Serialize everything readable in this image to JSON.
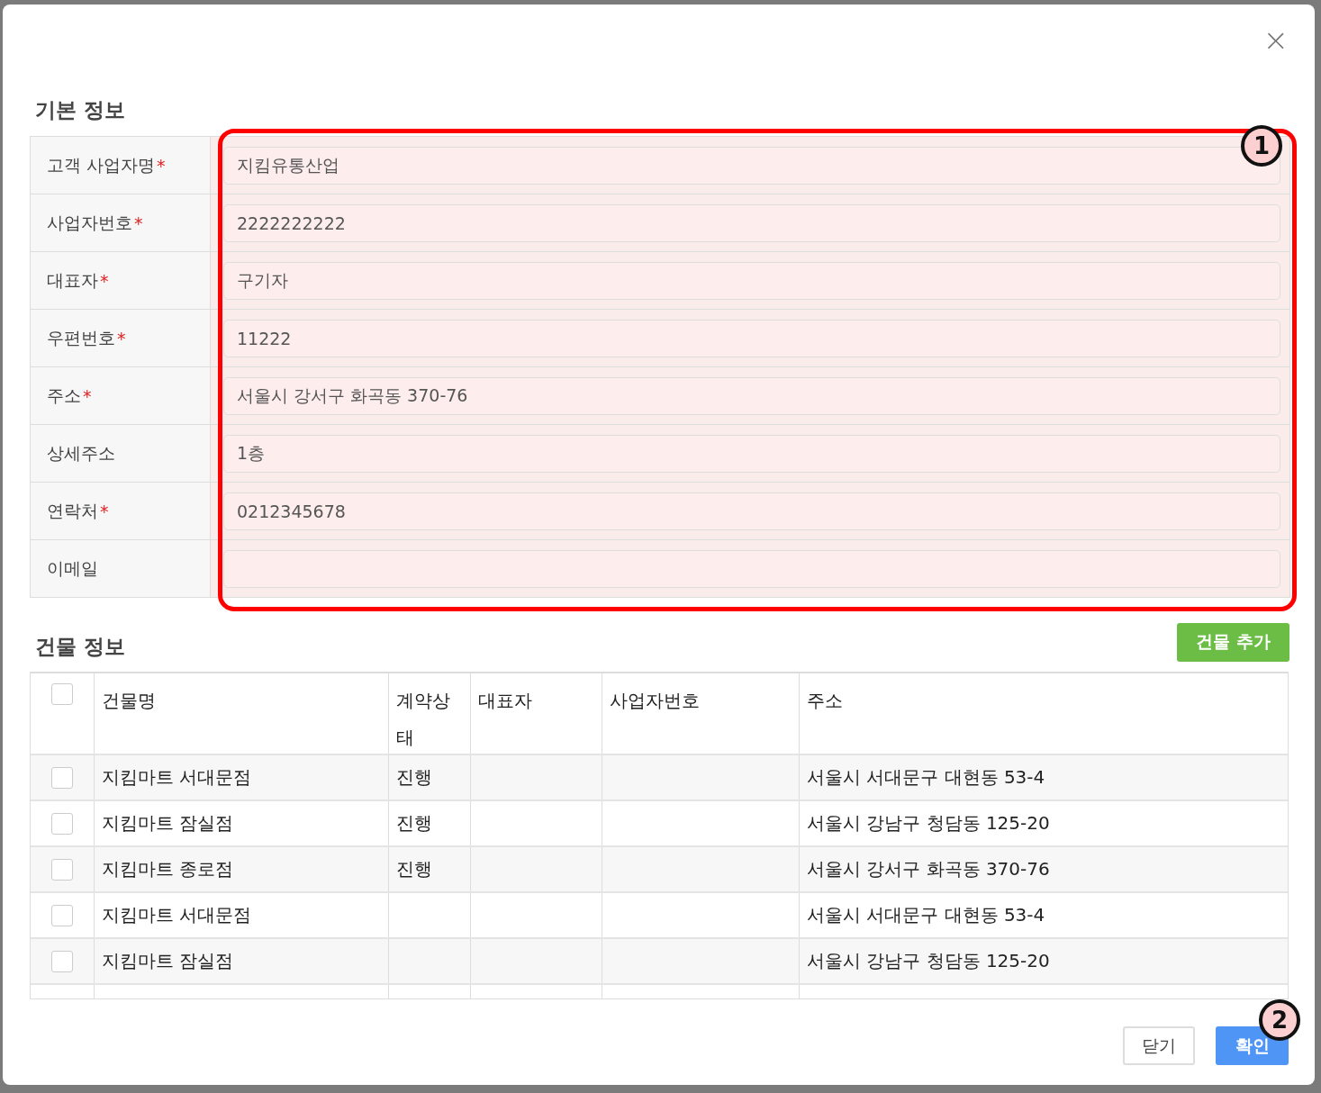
{
  "dialog": {
    "close_label": "×"
  },
  "basic_info": {
    "title": "기본 정보",
    "fields": [
      {
        "label": "고객 사업자명",
        "required_mark": "*",
        "value": "지킴유통산업"
      },
      {
        "label": "사업자번호",
        "required_mark": "*",
        "value": "2222222222"
      },
      {
        "label": "대표자",
        "required_mark": "*",
        "value": "구기자"
      },
      {
        "label": "우편번호",
        "required_mark": "*",
        "value": "11222"
      },
      {
        "label": "주소",
        "required_mark": "*",
        "value": "서울시 강서구 화곡동 370-76"
      },
      {
        "label": "상세주소",
        "value": "1층"
      },
      {
        "label": "연락처",
        "required_mark": "*",
        "value": "0212345678"
      },
      {
        "label": "이메일"
      }
    ]
  },
  "building_info": {
    "title": "건물 정보",
    "add_button": "건물 추가",
    "table": {
      "columns": [
        "건물명",
        "계약상태",
        "대표자",
        "사업자번호",
        "주소"
      ],
      "header_checked": false,
      "rows": [
        {
          "checked": false,
          "cells": [
            "지킴마트 서대문점",
            "진행",
            "",
            "",
            "서울시 서대문구 대현동 53-4"
          ]
        },
        {
          "checked": false,
          "cells": [
            "지킴마트 잠실점",
            "진행",
            "",
            "",
            "서울시 강남구 청담동 125-20"
          ]
        },
        {
          "checked": false,
          "cells": [
            "지킴마트 종로점",
            "진행",
            "",
            "",
            "서울시 강서구 화곡동 370-76"
          ]
        },
        {
          "checked": false,
          "cells": [
            "지킴마트 서대문점",
            "",
            "",
            "",
            "서울시 서대문구 대현동 53-4"
          ]
        },
        {
          "checked": false,
          "cells": [
            "지킴마트 잠실점",
            "",
            "",
            "",
            "서울시 강남구 청담동 125-20"
          ]
        }
      ]
    }
  },
  "footer": {
    "buttons": [
      {
        "label": "닫기",
        "kind": "secondary"
      },
      {
        "label": "확인",
        "kind": "primary"
      }
    ]
  },
  "annotations": [
    {
      "label": "1"
    },
    {
      "label": "2"
    }
  ]
}
